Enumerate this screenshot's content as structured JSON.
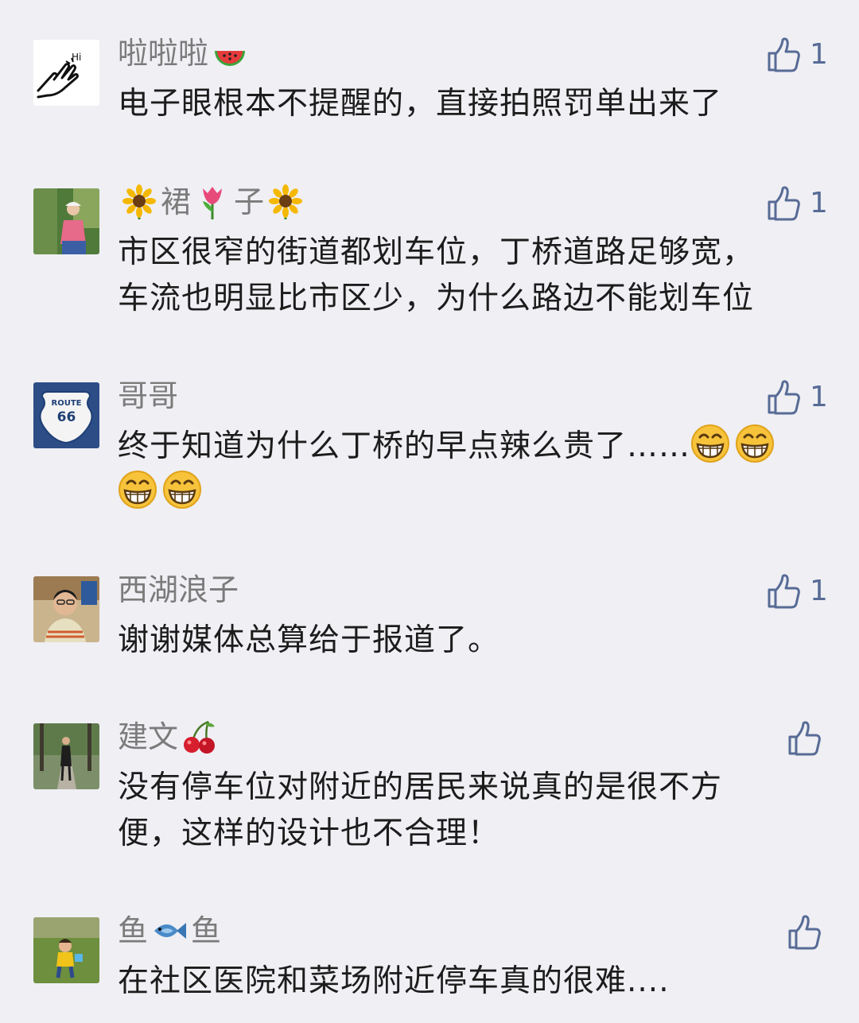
{
  "comments": [
    {
      "name_parts": [
        "啦啦啦",
        ""
      ],
      "name_emoji": "watermelon-icon",
      "lines": [
        "电子眼根本不提醒的，直接拍照罚单出来了"
      ],
      "likes": "1"
    },
    {
      "name_parts": [
        "裙",
        "子"
      ],
      "name_emoji": "sunflower-tulip-icon",
      "lines": [
        "市区很窄的街道都划车位，丁桥道路足够宽，",
        "车流也明显比市区少，为什么路边不能划车位"
      ],
      "likes": "1"
    },
    {
      "name_parts": [
        "哥哥"
      ],
      "avatar_sign_top": "ROUTE",
      "avatar_sign_num": "66",
      "lines": [
        "终于知道为什么丁桥的早点辣么贵了……"
      ],
      "likes": "1"
    },
    {
      "name_parts": [
        "西湖浪子"
      ],
      "lines": [
        "谢谢媒体总算给于报道了。"
      ],
      "likes": "1"
    },
    {
      "name_parts": [
        "建文",
        ""
      ],
      "name_emoji": "cherry-icon",
      "lines": [
        "没有停车位对附近的居民来说真的是很不方",
        "便，这样的设计也不合理！"
      ],
      "likes": ""
    },
    {
      "name_parts": [
        "鱼",
        "鱼"
      ],
      "name_emoji": "fish-icon",
      "lines": [
        "在社区医院和菜场附近停车真的很难...."
      ],
      "likes": ""
    }
  ],
  "colors": {
    "background": "#efeff4",
    "name": "#7b7b7b",
    "text": "#1c1c1c",
    "like": "#576b95"
  }
}
